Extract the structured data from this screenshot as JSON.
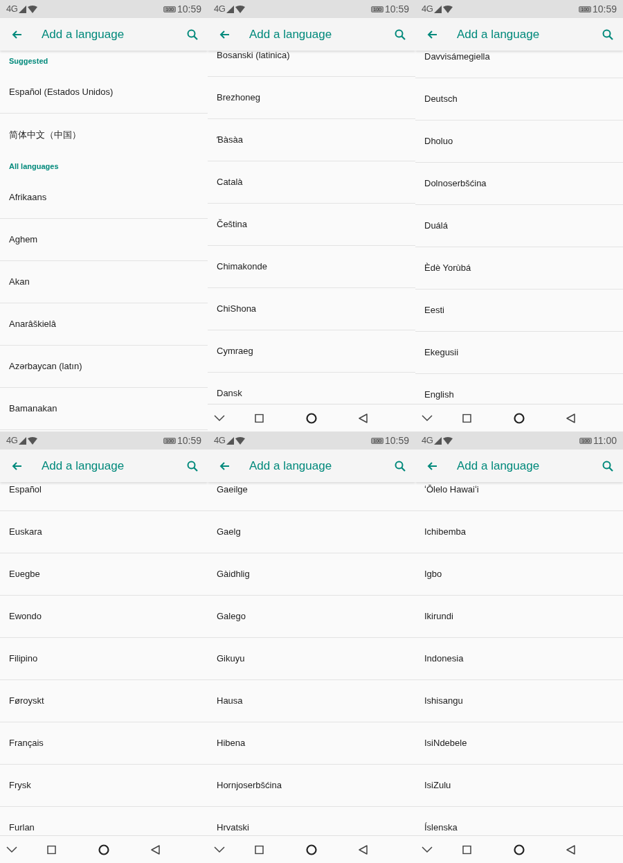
{
  "screens": [
    {
      "status_bar": {
        "network": "4G",
        "battery": "100",
        "time": "10:59"
      },
      "app_bar": {
        "title": "Add a language"
      },
      "nav_bar": false,
      "sections": [
        {
          "header": "Suggested",
          "items": [
            "Español (Estados Unidos)",
            "简体中文（中国）"
          ]
        },
        {
          "header": "All languages",
          "items": [
            "Afrikaans",
            "Aghem",
            "Akan",
            "Anarâškielâ",
            "Azərbaycan (latın)",
            "Bamanakan"
          ]
        }
      ]
    },
    {
      "status_bar": {
        "network": "4G",
        "battery": "100",
        "time": "10:59"
      },
      "app_bar": {
        "title": "Add a language"
      },
      "nav_bar": true,
      "sections": [
        {
          "items": [
            "Bosanski (latinica)",
            "Brezhoneg",
            "Ɓàsàa",
            "Català",
            "Čeština",
            "Chimakonde",
            "ChiShona",
            "Cymraeg",
            "Dansk"
          ]
        }
      ]
    },
    {
      "status_bar": {
        "network": "4G",
        "battery": "100",
        "time": "10:59"
      },
      "app_bar": {
        "title": "Add a language"
      },
      "nav_bar": true,
      "sections": [
        {
          "items": [
            "Davvisámegiella",
            "Deutsch",
            "Dholuo",
            "Dolnoserbšćina",
            "Duálá",
            "Èdè Yorùbá",
            "Eesti",
            "Ekegusii",
            "English"
          ]
        }
      ]
    },
    {
      "status_bar": {
        "network": "4G",
        "battery": "100",
        "time": "10:59"
      },
      "app_bar": {
        "title": "Add a language"
      },
      "nav_bar": true,
      "sections": [
        {
          "items": [
            "Español",
            "Euskara",
            "Eʋegbe",
            "Ewondo",
            "Filipino",
            "Føroyskt",
            "Français",
            "Frysk",
            "Furlan"
          ]
        }
      ]
    },
    {
      "status_bar": {
        "network": "4G",
        "battery": "100",
        "time": "10:59"
      },
      "app_bar": {
        "title": "Add a language"
      },
      "nav_bar": true,
      "sections": [
        {
          "items": [
            "Gaeilge",
            "Gaelg",
            "Gàidhlig",
            "Galego",
            "Gikuyu",
            "Hausa",
            "Hibena",
            "Hornjoserbšćina",
            "Hrvatski"
          ]
        }
      ]
    },
    {
      "status_bar": {
        "network": "4G",
        "battery": "100",
        "time": "11:00"
      },
      "app_bar": {
        "title": "Add a language"
      },
      "nav_bar": true,
      "sections": [
        {
          "items": [
            "ʻŌlelo Hawaiʻi",
            "Ichibemba",
            "Igbo",
            "Ikirundi",
            "Indonesia",
            "Ishisangu",
            "IsiNdebele",
            "IsiZulu",
            "Íslenska"
          ]
        }
      ]
    }
  ]
}
